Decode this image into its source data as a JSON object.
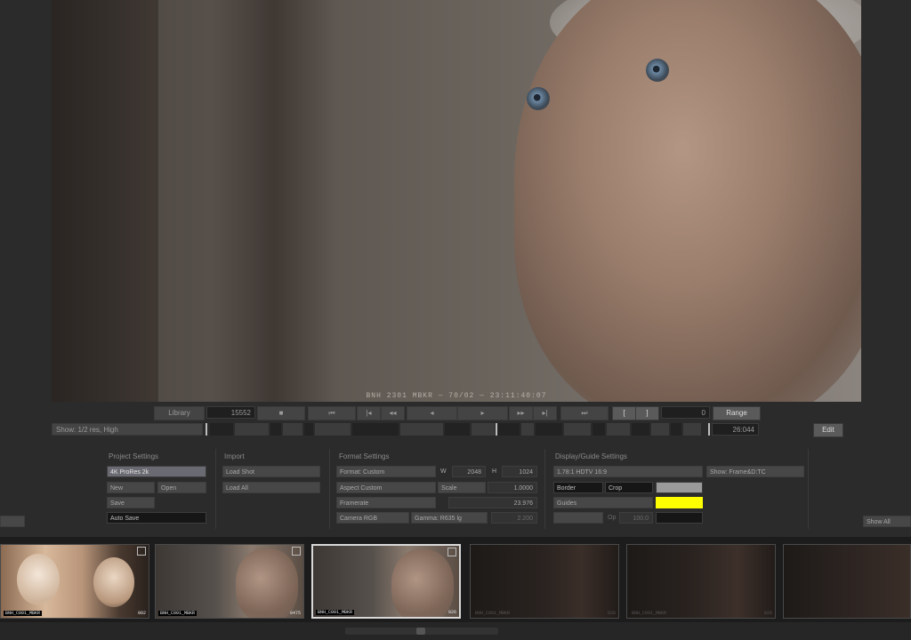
{
  "viewer": {
    "caption": "BNH 2301 MBKR — 70/02 — 23:11:40:07"
  },
  "transport": {
    "library_label": "Library",
    "frame_value": "15552",
    "range_label": "Range",
    "show_selector": "Show: 1/2 res, High",
    "end_timecode": "26:044",
    "right_button": "Edit",
    "counter_small": "0"
  },
  "project": {
    "title": "Project Settings",
    "preset": "4K ProRes 2k",
    "new_label": "New",
    "open_label": "Open",
    "save_label": "Save",
    "autosave_label": "Auto Save"
  },
  "import": {
    "title": "Import",
    "load_shot": "Load Shot",
    "load_all": "Load All"
  },
  "format": {
    "title": "Format Settings",
    "format_field": "Format: Custom",
    "aspect_field": "Aspect Custom",
    "framerate_field": "Framerate",
    "colorspace_field": "Camera RGB",
    "gamma_field": "Gamma: R635 lg",
    "w_label": "W",
    "w_value": "2048",
    "h_label": "H",
    "h_value": "1024",
    "scale_label": "Scale",
    "scale_value": "1.0000",
    "fps_value": "23.976",
    "gamma_value": "2.200"
  },
  "display": {
    "title": "Display/Guide Settings",
    "aspect_guide": "1.78:1 HDTV 16:9",
    "show_option": "Show: Frame&D:TC",
    "border_label": "Border",
    "crop_label": "Crop",
    "guides_label": "Guides",
    "op_label": "Op",
    "op_value": "100.0",
    "guide_color": "#ffff00",
    "border_swatch_color": "#9a9a9a"
  },
  "sidebar": {
    "show_all_label": "Show All"
  },
  "thumbnails": [
    {
      "clip": "BNH_C001_MBKR",
      "frames": "002"
    },
    {
      "clip": "BNH_C001_MBKR",
      "frames": "0475"
    },
    {
      "clip": "BNH_C001_MBKR",
      "frames": "026"
    },
    {
      "clip": "BNH_C001_MBKR",
      "frames": "026"
    },
    {
      "clip": "BNH_C001_MBKR",
      "frames": "026"
    },
    {
      "clip": "",
      "frames": ""
    }
  ]
}
